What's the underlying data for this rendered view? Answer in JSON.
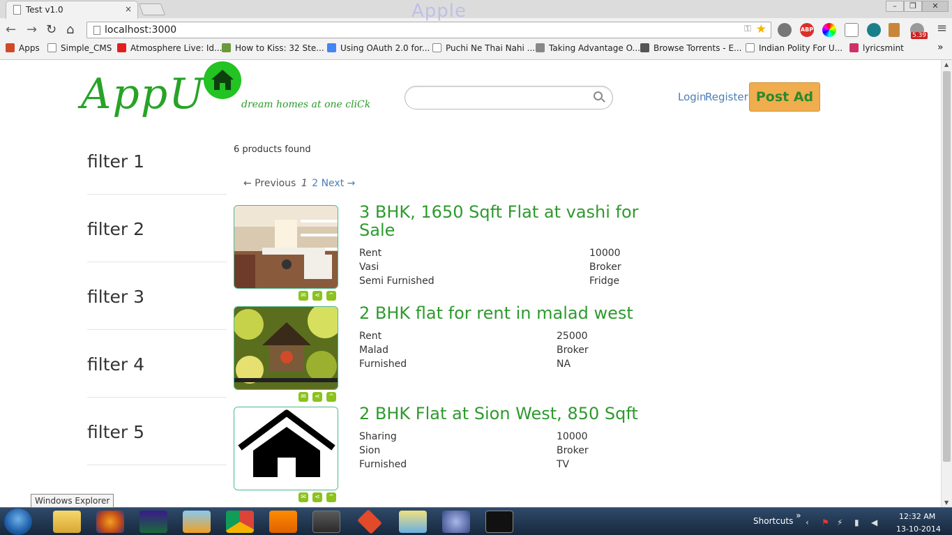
{
  "browser": {
    "tab_title": "Test v1.0",
    "tab_close": "×",
    "watermark": "Apple",
    "url": "localhost:3000",
    "window_buttons": [
      "–",
      "❐",
      "✕"
    ],
    "bookmarks": [
      {
        "label": "Apps",
        "color": "#d04a2a"
      },
      {
        "label": "Simple_CMS",
        "color": "#ffffff"
      },
      {
        "label": "Atmosphere Live: Id...",
        "color": "#e02020"
      },
      {
        "label": "How to Kiss: 32 Ste...",
        "color": "#6a9a3a"
      },
      {
        "label": "Using OAuth 2.0 for...",
        "color": "#4285f4"
      },
      {
        "label": "Puchi Ne Thai Nahi ...",
        "color": "#ffffff"
      },
      {
        "label": "Taking Advantage O...",
        "color": "#888888"
      },
      {
        "label": "Browse Torrents - E...",
        "color": "#555555"
      },
      {
        "label": "Indian Polity For U...",
        "color": "#ffffff"
      },
      {
        "label": "lyricsmint",
        "color": "#d0306a"
      }
    ],
    "bookmarks_more": "»",
    "extension_badge": "5.39"
  },
  "header": {
    "logo": "AppU",
    "tagline": "dream homes at one cliCk",
    "search_placeholder": "",
    "login": "Login",
    "register": "Register",
    "post_ad": "Post Ad"
  },
  "filters": [
    "filter 1",
    "filter 2",
    "filter 3",
    "filter 4",
    "filter 5"
  ],
  "results": {
    "count_text": "6 products found",
    "pager": {
      "prev": "← Previous",
      "current": "1",
      "page2": "2",
      "next": "Next →"
    }
  },
  "products": [
    {
      "title": "3 BHK, 1650 Sqft Flat at vashi for Sale",
      "left": [
        "Rent",
        "Vasi",
        "Semi Furnished"
      ],
      "right": [
        "10000",
        "Broker",
        "Fridge"
      ]
    },
    {
      "title": "2 BHK flat for rent in malad west",
      "left": [
        "Rent",
        "Malad",
        "Furnished"
      ],
      "right": [
        "25000",
        "Broker",
        "NA"
      ]
    },
    {
      "title": "2 BHK Flat at Sion West, 850 Sqft",
      "left": [
        "Sharing",
        "Sion",
        "Furnished"
      ],
      "right": [
        "10000",
        "Broker",
        "TV"
      ]
    }
  ],
  "taskbar": {
    "tooltip": "Windows Explorer",
    "shortcuts": "Shortcuts",
    "shortcuts_more": "»",
    "time": "12:32 AM",
    "date": "13-10-2014"
  }
}
